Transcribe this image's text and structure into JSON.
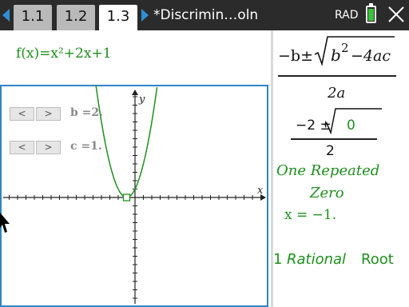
{
  "tabs": [
    {
      "label": "1.1",
      "active": false
    },
    {
      "label": "1.2",
      "active": false
    },
    {
      "label": "1.3",
      "active": true
    }
  ],
  "document_title": "*Discrimin…oln",
  "mode": "RAD",
  "battery_level": 0.85,
  "function_entry": "f(x)=x²+2x+1",
  "graph": {
    "x_axis_label": "x",
    "y_axis_label": "y",
    "sliders": [
      {
        "name": "b",
        "text": "b  =2.",
        "prev_glyph": "<",
        "next_glyph": ">"
      },
      {
        "name": "c",
        "text": "c  =1.",
        "prev_glyph": "<",
        "next_glyph": ">"
      }
    ],
    "function": {
      "a": 1,
      "b": 2,
      "c": 1,
      "color": "#1f8f1f"
    },
    "vertex": {
      "x": -1,
      "y": 0
    }
  },
  "quadratic_formula": {
    "numerator_prefix": "−b±",
    "radicand_b": "b",
    "radicand_exp": "2",
    "radicand_rest": "−4ac",
    "denominator": "2a"
  },
  "substituted": {
    "prefix": "−2 ±",
    "radicand": "0",
    "denominator": "2"
  },
  "result": {
    "line1": "One Repeated",
    "line2": "Zero",
    "solution": "x = −1.",
    "root_count": "1",
    "root_kind": "Rational",
    "root_word": "Root"
  },
  "colors": {
    "accent": "#2d86c6",
    "nav_arrows": "#2f8fd6",
    "function_green": "#1f8f1f",
    "titlebar": "#2b2b2b"
  }
}
